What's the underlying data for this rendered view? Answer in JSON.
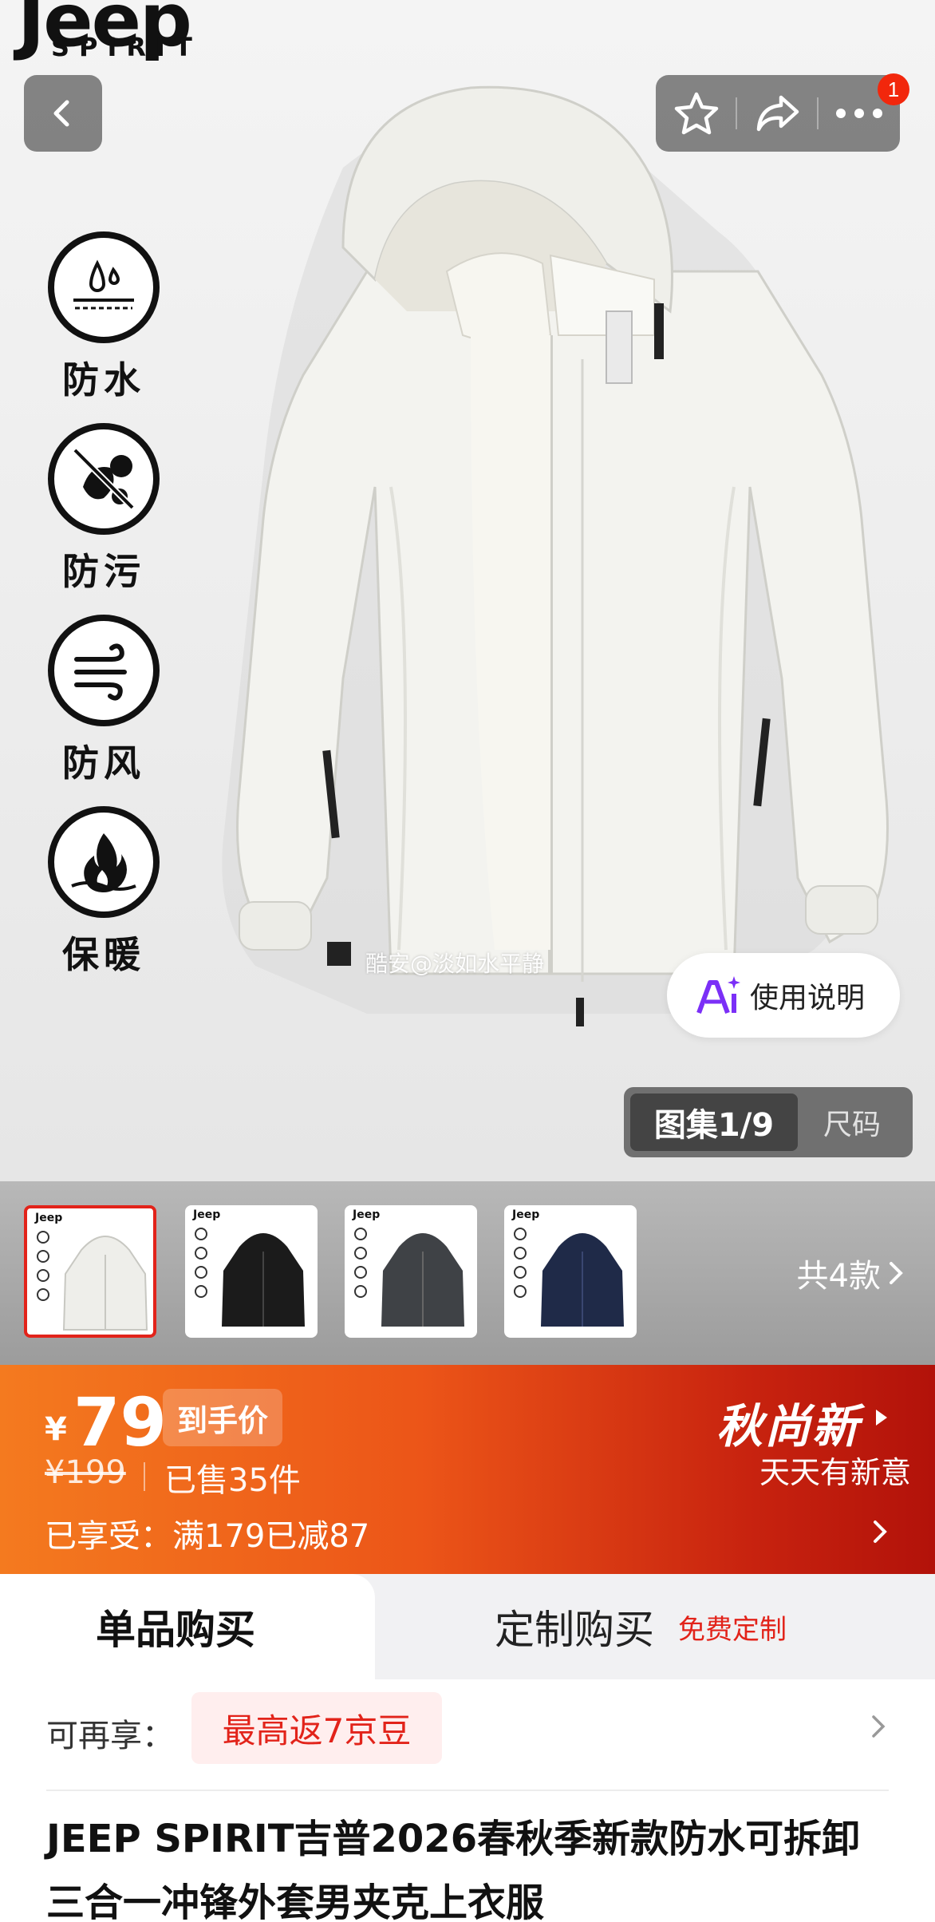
{
  "brand": {
    "logo_word": "Jeep",
    "logo_sub": "SPIRIT",
    "logo_mark": "®"
  },
  "header": {
    "back_icon": "chevron-left-icon",
    "actions": [
      "star-icon",
      "share-icon",
      "more-icon"
    ],
    "notification_count": "1"
  },
  "features": [
    {
      "label": "防水",
      "icon": "waterproof-icon"
    },
    {
      "label": "防污",
      "icon": "stainproof-icon"
    },
    {
      "label": "防风",
      "icon": "windproof-icon"
    },
    {
      "label": "保暖",
      "icon": "warmth-icon"
    }
  ],
  "watermark": "酷安@淡如水平静",
  "manual": {
    "label": "使用说明"
  },
  "gallery_switch": {
    "active": "图集1/9",
    "inactive": "尺码"
  },
  "variants": {
    "count_label": "共4款",
    "colors": [
      "#eeeeea",
      "#1b1b1b",
      "#3f4246",
      "#1f2a48"
    ]
  },
  "price": {
    "currency": "¥",
    "amount": "79",
    "tag": "到手价",
    "original": "¥199",
    "sold": "已售35件",
    "promo": "已享受：满179已减87",
    "season_title": "秋尚新",
    "season_slogan": "天天有新意"
  },
  "purchase_tabs": {
    "single": "单品购买",
    "custom": "定制购买",
    "custom_badge": "免费定制"
  },
  "benefit": {
    "label": "可再享：",
    "pill": "最高返7京豆"
  },
  "product": {
    "title": "JEEP SPIRIT吉普2026春秋季新款防水可拆卸三合一冲锋外套男夹克上衣服"
  },
  "theme": {
    "accent": "#e2231a",
    "banner_start": "#f47a1f",
    "banner_end": "#b2120a"
  }
}
